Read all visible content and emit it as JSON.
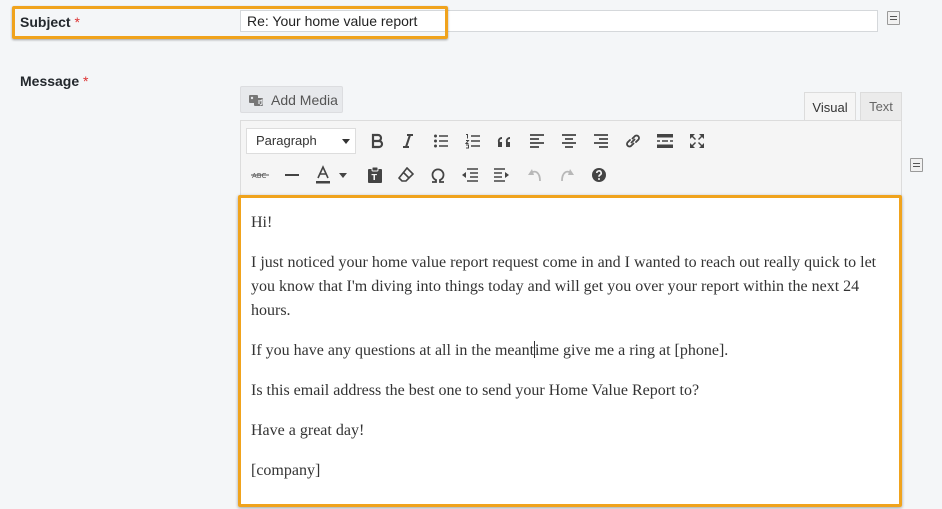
{
  "subject": {
    "label": "Subject",
    "required_mark": "*",
    "value": "Re: Your home value report"
  },
  "message": {
    "label": "Message",
    "required_mark": "*"
  },
  "add_media": {
    "label": "Add Media",
    "icon": "add-media-icon"
  },
  "tabs": [
    {
      "label": "Visual",
      "active": true
    },
    {
      "label": "Text",
      "active": false
    }
  ],
  "toolbar": {
    "format_select": "Paragraph",
    "row1": [
      "bold",
      "italic",
      "bulleted-list",
      "numbered-list",
      "blockquote",
      "align-left",
      "align-center",
      "align-right",
      "insert-link",
      "read-more",
      "fullscreen"
    ],
    "row2": [
      "strikethrough",
      "horizontal-line",
      "text-color",
      "paste-as-text",
      "clear-formatting",
      "special-character",
      "decrease-indent",
      "increase-indent",
      "undo",
      "redo",
      "keyboard-shortcuts"
    ]
  },
  "body": {
    "p1": "Hi!",
    "p2": "I just noticed your home value report request come in and I wanted to reach out really quick to let you know that I'm diving into things today and will get you over your report within the next 24 hours.",
    "p3_before_cursor": "If you have any questions at all in the meant",
    "p3_after_cursor": "ime give me a ring at [phone].",
    "p4": "Is this email address the best one to send your Home Value Report to?",
    "p5": "Have a great day!",
    "p6": "[company]"
  },
  "colors": {
    "highlight": "#f0a31d",
    "required": "#dc3232",
    "background": "#f4f6f8"
  }
}
